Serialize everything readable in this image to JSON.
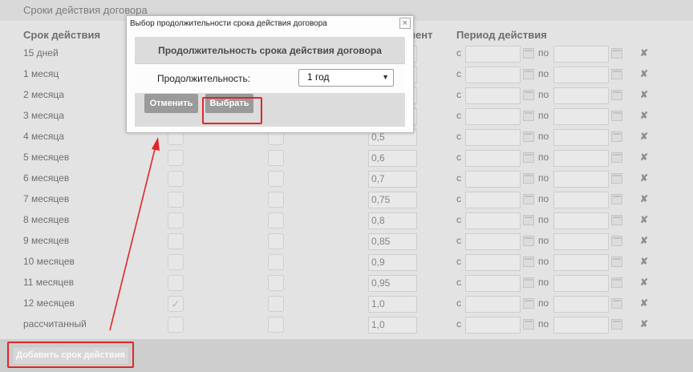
{
  "section_title": "Сроки действия договора",
  "columns": {
    "period": "Срок действия",
    "coefficient": "иент",
    "validity_period": "Период действия"
  },
  "row_labels": {
    "from": "с",
    "to": "по"
  },
  "rows": [
    {
      "label": "15 дней",
      "coef": "",
      "checked": false
    },
    {
      "label": "1 месяц",
      "coef": "",
      "checked": false
    },
    {
      "label": "2 месяца",
      "coef": "",
      "checked": false
    },
    {
      "label": "3 месяца",
      "coef": "",
      "checked": false
    },
    {
      "label": "4 месяца",
      "coef": "0,5",
      "checked": false
    },
    {
      "label": "5 месяцев",
      "coef": "0,6",
      "checked": false
    },
    {
      "label": "6 месяцев",
      "coef": "0,7",
      "checked": false
    },
    {
      "label": "7 месяцев",
      "coef": "0,75",
      "checked": false
    },
    {
      "label": "8 месяцев",
      "coef": "0,8",
      "checked": false
    },
    {
      "label": "9 месяцев",
      "coef": "0,85",
      "checked": false
    },
    {
      "label": "10 месяцев",
      "coef": "0,9",
      "checked": false
    },
    {
      "label": "11 месяцев",
      "coef": "0,95",
      "checked": false
    },
    {
      "label": "12 месяцев",
      "coef": "1,0",
      "checked": true
    },
    {
      "label": "рассчитанный",
      "coef": "1,0",
      "checked": false
    }
  ],
  "footer": {
    "add_button": "Добавить срок действия"
  },
  "dialog": {
    "window_title": "Выбор продолжительности срока действия договора",
    "close_glyph": "×",
    "heading": "Продолжительность срока действия договора",
    "field_label": "Продолжительность:",
    "selected_value": "1 год",
    "cancel_button": "Отменить",
    "select_button": "Выбрать"
  },
  "icons": {
    "delete": "delete-icon",
    "calendar": "calendar-icon",
    "check": "checkmark-icon",
    "dropdown": "dropdown-caret-icon"
  },
  "colors": {
    "highlight": "#e0262b",
    "dialog_button": "#9a9a9a"
  }
}
